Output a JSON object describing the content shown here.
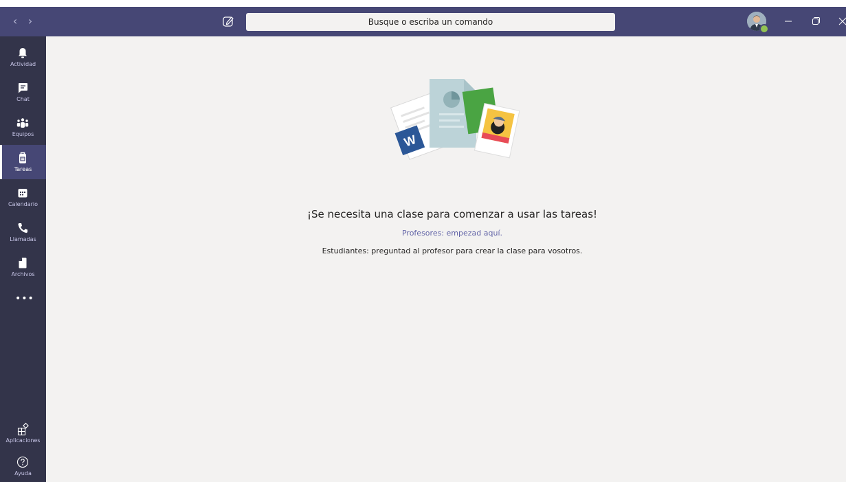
{
  "titlebar": {
    "search_placeholder": "Busque o escriba un comando",
    "back_icon": "chevron-left-icon",
    "forward_icon": "chevron-right-icon",
    "compose_icon": "compose-icon"
  },
  "rail": {
    "items": [
      {
        "label": "Actividad",
        "icon": "bell-icon"
      },
      {
        "label": "Chat",
        "icon": "chat-icon"
      },
      {
        "label": "Equipos",
        "icon": "teams-icon"
      },
      {
        "label": "Tareas",
        "icon": "assignments-icon",
        "active": true
      },
      {
        "label": "Calendario",
        "icon": "calendar-icon"
      },
      {
        "label": "Llamadas",
        "icon": "phone-icon"
      },
      {
        "label": "Archivos",
        "icon": "file-icon"
      }
    ],
    "more": "•••",
    "bottom": [
      {
        "label": "Aplicaciones",
        "icon": "apps-icon"
      },
      {
        "label": "Ayuda",
        "icon": "help-icon"
      }
    ]
  },
  "main": {
    "heading": "¡Se necesita una clase para comenzar a usar las tareas!",
    "teacher_link": "Profesores: empezad aquí.",
    "student_text": "Estudiantes: preguntad al profesor para crear la clase para vosotros."
  },
  "colors": {
    "titlebar": "#464775",
    "rail": "#33344a",
    "background": "#f3f2f1",
    "accent": "#6264a7"
  }
}
